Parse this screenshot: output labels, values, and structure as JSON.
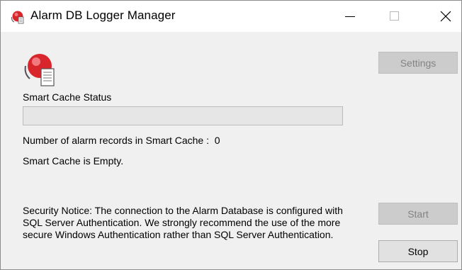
{
  "window": {
    "title": "Alarm DB Logger Manager",
    "controls": {
      "minimize_icon": "minimize-icon",
      "maximize_icon": "maximize-icon",
      "close_icon": "close-icon"
    }
  },
  "app_icon": "alarm-logger-icon",
  "cache": {
    "status_label": "Smart Cache Status",
    "progress_fraction": 0,
    "records_label": "Number of alarm records in Smart Cache :",
    "records_count": "0",
    "state_text": "Smart Cache is Empty."
  },
  "notice": {
    "text": "Security Notice: The connection to the Alarm Database is configured with SQL Server Authentication. We strongly recommend the use of the more secure Windows Authentication rather than SQL Server Authentication."
  },
  "buttons": {
    "settings": {
      "label": "Settings",
      "enabled": false
    },
    "start": {
      "label": "Start",
      "enabled": false
    },
    "stop": {
      "label": "Stop",
      "enabled": true
    }
  },
  "colors": {
    "icon_red": "#d9262c",
    "disabled_button": "#cccccc",
    "progress_fill": "#06b025"
  }
}
